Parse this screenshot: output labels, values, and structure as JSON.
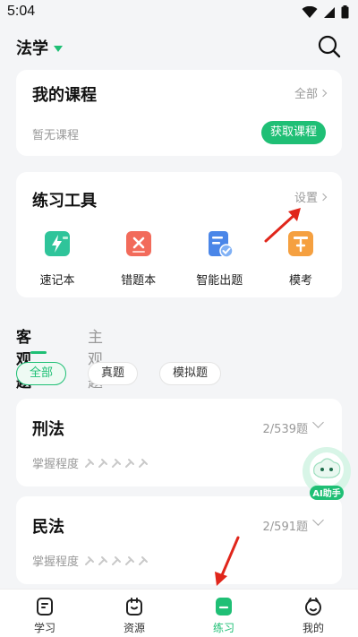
{
  "status": {
    "time": "5:04"
  },
  "header": {
    "subject": "法学"
  },
  "my_courses": {
    "title": "我的课程",
    "more": "全部",
    "empty": "暂无课程",
    "action": "获取课程"
  },
  "tools": {
    "title": "练习工具",
    "more": "设置",
    "items": [
      {
        "label": "速记本",
        "icon": "flashcard-icon",
        "color": "#2fc49a"
      },
      {
        "label": "错题本",
        "icon": "wrong-book-icon",
        "color": "#f26b5b"
      },
      {
        "label": "智能出题",
        "icon": "smart-quiz-icon",
        "color": "#4a86e8"
      },
      {
        "label": "模考",
        "icon": "mock-exam-icon",
        "color": "#f5a040"
      }
    ]
  },
  "question_tabs": [
    {
      "label": "客观题"
    },
    {
      "label": "主观题"
    }
  ],
  "filters": [
    {
      "label": "全部"
    },
    {
      "label": "真题"
    },
    {
      "label": "模拟题"
    }
  ],
  "subjects": [
    {
      "name": "刑法",
      "count": "2/539题",
      "mastery_label": "掌握程度",
      "mastery_level": 0
    },
    {
      "name": "民法",
      "count": "2/591题",
      "mastery_label": "掌握程度",
      "mastery_level": 0
    }
  ],
  "ai_assistant": {
    "label": "AI助手"
  },
  "bottom_nav": [
    {
      "label": "学习",
      "icon": "study-icon"
    },
    {
      "label": "资源",
      "icon": "resources-icon"
    },
    {
      "label": "练习",
      "icon": "practice-icon"
    },
    {
      "label": "我的",
      "icon": "profile-icon"
    }
  ],
  "colors": {
    "accent": "#1fbf75",
    "annotation_arrow": "#e0261b"
  }
}
